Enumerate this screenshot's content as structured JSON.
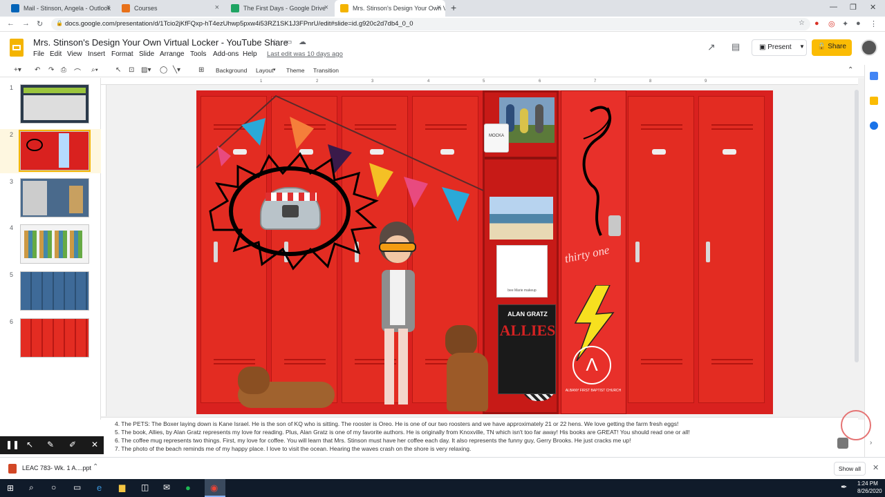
{
  "browser": {
    "tabs": [
      {
        "label": "Mail - Stinson, Angela - Outlook",
        "close": "×",
        "color": "#0364b8"
      },
      {
        "label": "Courses",
        "close": "×",
        "color": "#e8711a"
      },
      {
        "label": "The First Days - Google Drive",
        "close": "×",
        "color": "#1fa463"
      },
      {
        "label": "Mrs. Stinson's Design Your Own V",
        "close": "×",
        "color": "#f4b400"
      }
    ],
    "new_tab": "+",
    "url": "docs.google.com/presentation/d/1Tcio2jKfFQxp-hT4ezUhwp5pxw4i53RZ1SK1J3FPnrU/edit#slide=id.g920c2d7db4_0_0"
  },
  "doc": {
    "title": "Mrs. Stinson's Design Your Own Virtual Locker - YouTube Share",
    "menu": [
      "File",
      "Edit",
      "View",
      "Insert",
      "Format",
      "Slide",
      "Arrange",
      "Tools",
      "Add-ons",
      "Help"
    ],
    "last_edit": "Last edit was 10 days ago",
    "present": "Present",
    "share": "Share"
  },
  "toolbar": {
    "background": "Background",
    "layout": "Layout",
    "theme": "Theme",
    "transition": "Transition"
  },
  "ruler": [
    "1",
    "2",
    "3",
    "4",
    "5",
    "6",
    "7",
    "8",
    "9"
  ],
  "slides": [
    {
      "num": "1",
      "selected": false
    },
    {
      "num": "2",
      "selected": true
    },
    {
      "num": "3",
      "selected": false
    },
    {
      "num": "4",
      "selected": false
    },
    {
      "num": "5",
      "selected": false
    },
    {
      "num": "6",
      "selected": false
    }
  ],
  "slide_content": {
    "thirty_one": "thirty one",
    "book_author": "ALAN GRATZ",
    "book_title": "ALLIES",
    "church": "ALBANY FIRST BAPTIST CHURCH",
    "mug": "MOCKA",
    "makeup": "bee Marie makeup"
  },
  "notes": [
    "4.   The PETS: The Boxer laying down is Kane Israel.  He is the son of KQ who is sitting.  The rooster is Oreo.  He is one of our two roosters and we have approximately 21 or 22 hens.  We love getting the farm fresh eggs!",
    "5.   The book, Allies, by Alan Gratz represents my love for reading.  Plus, Alan Gratz is one of my favorite authors.  He is originally from Knoxville, TN which isn't too far away! His books are GREAT! You should read one or all!",
    "6.   The coffee mug represents two things.  First, my love for coffee.  You will learn that Mrs. Stinson must have her coffee each day.  It also represents the funny guy, Gerry Brooks.  He just cracks me up!",
    "7.   The photo of the beach reminds me of my happy place.  I love to visit the ocean.  Hearing the waves crash on the shore is very relaxing."
  ],
  "downloads": {
    "file": "LEAC 783- Wk. 1 A....ppt",
    "show_all": "Show all"
  },
  "taskbar": {
    "time": "1:24 PM",
    "date": "8/26/2020"
  }
}
